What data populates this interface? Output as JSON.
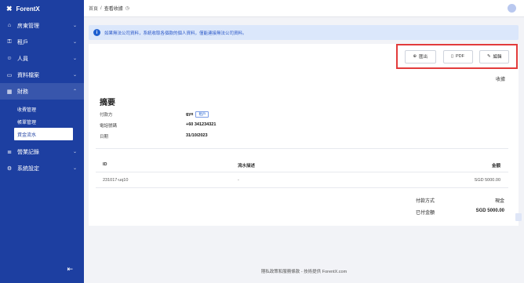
{
  "app": {
    "name": "ForentX"
  },
  "sidebar": {
    "items": [
      {
        "label": "房東管理",
        "icon": "house-icon"
      },
      {
        "label": "租戶",
        "icon": "key-icon"
      },
      {
        "label": "人員",
        "icon": "user-icon"
      },
      {
        "label": "資料檔案",
        "icon": "folder-icon"
      },
      {
        "label": "財務",
        "icon": "calculator-icon"
      },
      {
        "label": "營業記錄",
        "icon": "list-icon"
      },
      {
        "label": "系統設定",
        "icon": "gear-icon"
      }
    ],
    "sub_items": [
      "收費管理",
      "帳單管理",
      "資金流水"
    ],
    "selected_sub": "資金流水"
  },
  "topbar": {
    "crumb_parent": "首頁",
    "crumb_sep": "/",
    "crumb_current": "查看收據"
  },
  "banner": {
    "text": "如果無法公司資料，系統收取各個款的個人資料，僅能連接無法公司資料。"
  },
  "actions": {
    "export_label": "匯出",
    "pdf_label": "PDF",
    "edit_label": "編輯"
  },
  "receipt_label": "收據",
  "summary": {
    "title": "摘要",
    "payer_label": "付款方",
    "payer_value": "gyx",
    "payer_tag": "租戶",
    "phone_label": "電話號碼",
    "phone_value": "+60 341234321",
    "date_label": "日期",
    "date_value": "31/10/2023"
  },
  "table": {
    "headers": {
      "id": "ID",
      "desc": "流水描述",
      "amount": "金額"
    },
    "rows": [
      {
        "id": "231017-uq10",
        "desc": "-",
        "amount": "SGD 5000.00"
      }
    ]
  },
  "totals": {
    "method_label": "付款方式",
    "method_value": "現金",
    "paid_label": "已付金額",
    "paid_value": "SGD 5000.00"
  },
  "footer": "隱私政策和服務條款 - 技術提供 ForentX.com",
  "colors": {
    "sidebar": "#1d3fa1",
    "banner_bg": "#dbe7fb",
    "highlight": "#e23b3b"
  }
}
